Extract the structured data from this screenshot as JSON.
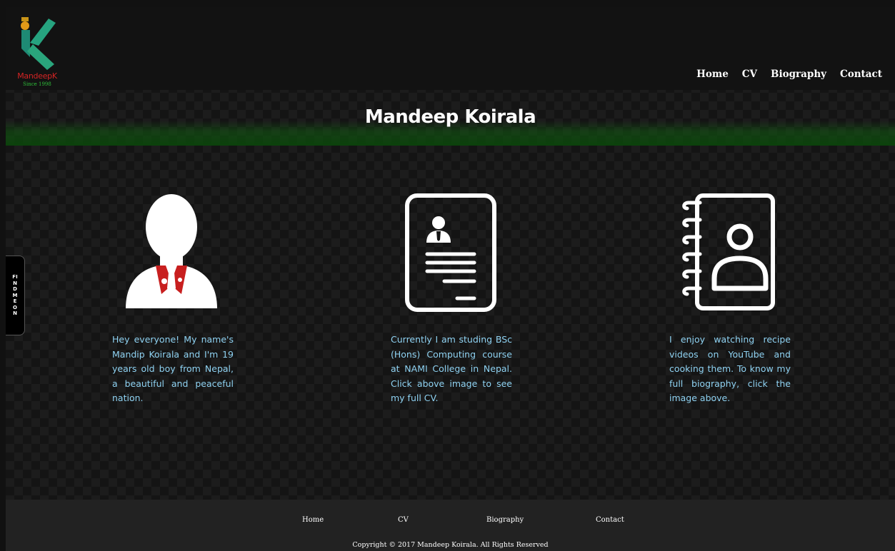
{
  "logo": {
    "name": "MandeepK",
    "since": "Since 1998"
  },
  "nav": {
    "items": [
      "Home",
      "CV",
      "Biography",
      "Contact"
    ]
  },
  "banner": {
    "title": "Mandeep Koirala"
  },
  "side_tab": {
    "label": "FIND ME ON"
  },
  "columns": [
    {
      "icon": "person-avatar-icon",
      "text": "Hey everyone! My name's Mandip Koirala and I'm 19 years old boy from Nepal, a beautiful and peaceful nation."
    },
    {
      "icon": "resume-document-icon",
      "text": "Currently I am studing BSc (Hons) Computing course at NAMI College in Nepal. Click above image to see my full CV."
    },
    {
      "icon": "contact-book-icon",
      "text": "I enjoy watching recipe videos on YouTube and cooking them. To know my full biography, click the image above."
    }
  ],
  "footer": {
    "links": [
      "Home",
      "CV",
      "Biography",
      "Contact"
    ],
    "copyright": "Copyright © 2017 Mandeep Koirala. All Rights Reserved"
  },
  "colors": {
    "background": "#141414",
    "body_text": "#8fd2f2",
    "banner_glow": "#0a460a",
    "footer_bg": "#222222",
    "logo_red": "#d42424",
    "logo_green": "#2fbf3a"
  }
}
